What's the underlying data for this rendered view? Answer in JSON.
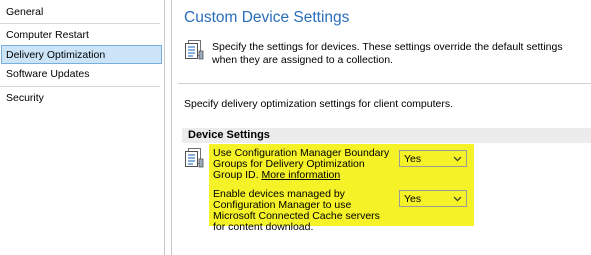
{
  "nav": {
    "items": [
      {
        "label": "General"
      },
      {
        "label": "Computer Restart"
      },
      {
        "label": "Delivery Optimization"
      },
      {
        "label": "Software Updates"
      },
      {
        "label": "Security"
      }
    ],
    "selected": "Delivery Optimization"
  },
  "header": {
    "title": "Custom Device Settings",
    "description": "Specify the settings for devices. These settings override the default settings when they are assigned to a collection.",
    "icon": "document-settings-icon"
  },
  "content": {
    "subtitle": "Specify delivery optimization settings for client computers.",
    "section_title": "Device Settings",
    "settings_icon": "document-settings-icon",
    "settings": [
      {
        "label": "Use Configuration Manager Boundary Groups for Delivery Optimization Group ID.",
        "link": "More information",
        "value": "Yes"
      },
      {
        "label": "Enable devices managed by Configuration Manager to use Microsoft Connected Cache servers for content download.",
        "value": "Yes"
      }
    ]
  },
  "colors": {
    "accent_title": "#2a6ebb",
    "selection": "#cce4f7",
    "highlight": "#f5f227"
  }
}
